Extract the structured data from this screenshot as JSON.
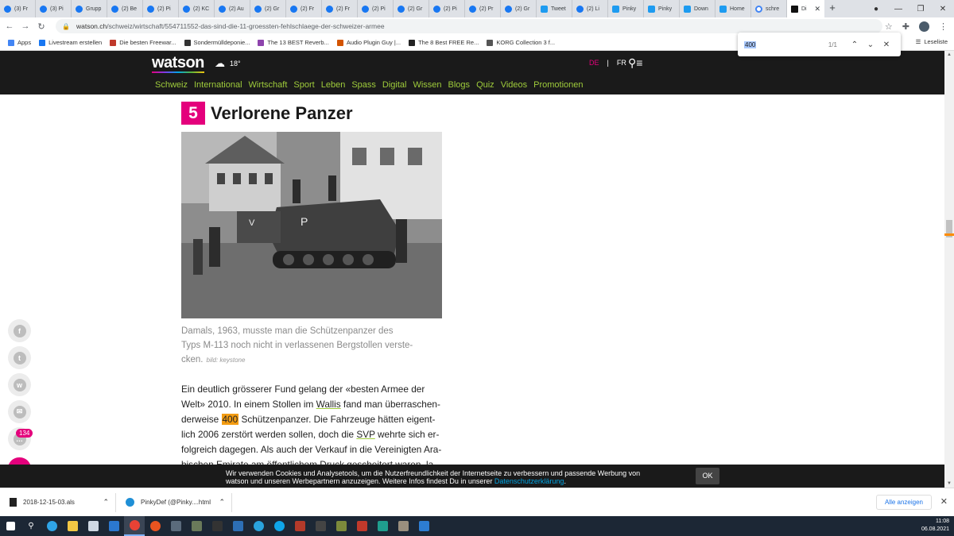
{
  "browser": {
    "tabs": [
      {
        "label": "(3) Fr",
        "icon": "facebook-icon"
      },
      {
        "label": "(3) Pi",
        "icon": "facebook-icon"
      },
      {
        "label": "Grupp",
        "icon": "facebook-icon"
      },
      {
        "label": "(2) Be",
        "icon": "facebook-icon"
      },
      {
        "label": "(2) Pi",
        "icon": "facebook-icon"
      },
      {
        "label": "(2) KC",
        "icon": "facebook-icon"
      },
      {
        "label": "(2) Au",
        "icon": "facebook-icon"
      },
      {
        "label": "(2) Gr",
        "icon": "facebook-icon"
      },
      {
        "label": "(2) Fr",
        "icon": "facebook-icon"
      },
      {
        "label": "(2) Fr",
        "icon": "facebook-icon"
      },
      {
        "label": "(2) Pi",
        "icon": "facebook-icon"
      },
      {
        "label": "(2) Gr",
        "icon": "facebook-icon"
      },
      {
        "label": "(2) Pi",
        "icon": "facebook-icon"
      },
      {
        "label": "(2) Pr",
        "icon": "facebook-icon"
      },
      {
        "label": "(2) Gr",
        "icon": "facebook-icon"
      },
      {
        "label": "Tweet",
        "icon": "twitter-icon"
      },
      {
        "label": "(2) Li",
        "icon": "facebook-icon"
      },
      {
        "label": "Pinky",
        "icon": "twitter-icon"
      },
      {
        "label": "Pinky",
        "icon": "twitter-icon"
      },
      {
        "label": "Down",
        "icon": "twitter-icon"
      },
      {
        "label": "Home",
        "icon": "twitter-icon"
      },
      {
        "label": "schre",
        "icon": "google-icon"
      },
      {
        "label": "Di",
        "icon": "watson-icon",
        "active": true
      }
    ],
    "url_host": "watson.ch",
    "url_path": "/schweiz/wirtschaft/554711552-das-sind-die-11-groessten-fehlschlaege-der-schweizer-armee",
    "bookmarks": [
      {
        "label": "Apps"
      },
      {
        "label": "Livestream erstellen"
      },
      {
        "label": "Die besten Freewar..."
      },
      {
        "label": "Sondermülldeponie..."
      },
      {
        "label": "The 13 BEST Reverb..."
      },
      {
        "label": "Audio Plugin Guy |..."
      },
      {
        "label": "The 8 Best FREE Re..."
      },
      {
        "label": "KORG Collection 3 f..."
      }
    ],
    "reading_list": "Leseliste",
    "find": {
      "query": "400",
      "count": "1/1"
    }
  },
  "site": {
    "logo": "watson",
    "temperature": "18°",
    "lang_de": "DE",
    "lang_sep": "|",
    "lang_fr": "FR",
    "nav": [
      "Schweiz",
      "International",
      "Wirtschaft",
      "Sport",
      "Leben",
      "Spass",
      "Digital",
      "Wissen",
      "Blogs",
      "Quiz",
      "Videos",
      "Promotionen"
    ]
  },
  "article": {
    "number": "5",
    "heading": "Verlorene Panzer",
    "caption_l1": "Damals, 1963, musste man die Schützenpanzer des",
    "caption_l2": "Typs M-113 noch nicht in verlassenen Bergstollen verste-",
    "caption_l3": "cken.",
    "credit": "bild: keystone",
    "p1a": "Ein deutlich grösserer Fund gelang der «besten Armee der",
    "p1b": "Welt» 2010. In einem Stollen im ",
    "p1b_u": "Wallis",
    "p1b_end": " fand man überraschen-",
    "p1c_start": "derweise ",
    "p1c_hl": "400",
    "p1c_end": " Schützenpanzer. Die Fahrzeuge hätten eigent-",
    "p1d_start": "lich 2006 zerstört werden sollen, doch die ",
    "p1d_u": "SVP",
    "p1d_end": " wehrte sich er-",
    "p1e": "folgreich dagegen. Als auch der Verkauf in die Vereinigten Ara-",
    "p1f": "bischen Emirate am öffentlichem Druck gescheitert waren, la-"
  },
  "share": {
    "comment_count": "134"
  },
  "cookie": {
    "line1": "Wir verwenden Cookies und Analysetools, um die Nutzerfreundlichkeit der Internetseite zu verbessern und passende Werbung von",
    "line2": "watson und unseren Werbepartnern anzuzeigen. Weitere Infos findest Du in unserer ",
    "link": "Datenschutzerklärung",
    "line2_end": ".",
    "ok": "OK"
  },
  "downloads": {
    "items": [
      "2018-12-15-03.als",
      "PinkyDef (@Pinky....html"
    ],
    "show_all": "Alle anzeigen"
  },
  "taskbar": {
    "time": "11:08",
    "date": "06.08.2021"
  },
  "colors": {
    "brand_pink": "#e4007c",
    "nav_green": "#9fcc3b",
    "find_highlight": "#f39c12"
  }
}
